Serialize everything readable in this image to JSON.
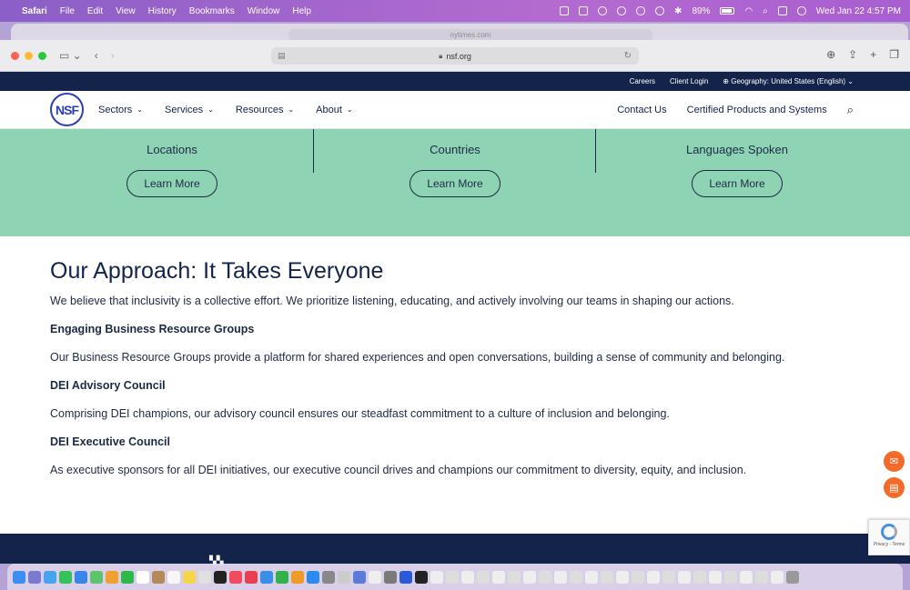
{
  "menubar": {
    "app": "Safari",
    "items": [
      "File",
      "Edit",
      "View",
      "History",
      "Bookmarks",
      "Window",
      "Help"
    ],
    "battery": "89%",
    "datetime": "Wed Jan 22  4:57 PM"
  },
  "background_window": {
    "url": "nytimes.com"
  },
  "browser": {
    "url": "nsf.org"
  },
  "topbar": {
    "careers": "Careers",
    "client_login": "Client Login",
    "geography": "Geography: United States (English)"
  },
  "nav": {
    "logo": "NSF",
    "items": [
      "Sectors",
      "Services",
      "Resources",
      "About"
    ],
    "contact": "Contact Us",
    "certified": "Certified Products and Systems"
  },
  "stats": [
    {
      "label": "Locations",
      "button": "Learn More"
    },
    {
      "label": "Countries",
      "button": "Learn More"
    },
    {
      "label": "Languages Spoken",
      "button": "Learn More"
    }
  ],
  "content": {
    "title": "Our Approach: It Takes Everyone",
    "intro": "We believe that inclusivity is a collective effort. We prioritize listening, educating, and actively involving our teams in shaping our actions.",
    "sections": [
      {
        "heading": "Engaging Business Resource Groups",
        "text": "Our Business Resource Groups provide a platform for shared experiences and open conversations, building a sense of community and belonging."
      },
      {
        "heading": "DEI Advisory Council",
        "text": "Comprising DEI champions, our advisory council ensures our steadfast commitment to a culture of inclusion and belonging."
      },
      {
        "heading": "DEI Executive Council",
        "text": "As executive sponsors for all DEI initiatives, our executive council drives and champions our commitment to diversity, equity, and inclusion."
      }
    ]
  },
  "recaptcha": {
    "text": "Privacy - Terms"
  },
  "colors": {
    "navy": "#13234a",
    "mint": "#8fd3b5",
    "orange": "#f26b2b",
    "nsf_blue": "#2b3fb8"
  }
}
